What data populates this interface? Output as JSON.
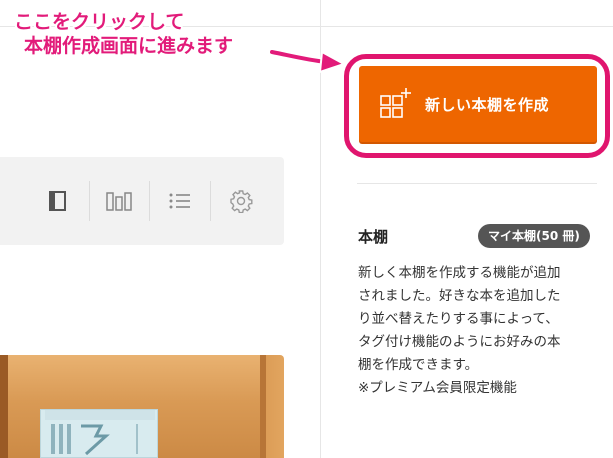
{
  "annotation": {
    "line1": "ここをクリックして",
    "line2": "本棚作成画面に進みます",
    "color": "#e21b7a"
  },
  "create_button": {
    "label": "新しい本棚を作成",
    "icon": "grid-plus-icon",
    "color": "#ee6600"
  },
  "toolbar": {
    "buttons": [
      {
        "icon": "single-book-view-icon"
      },
      {
        "icon": "shelf-view-icon"
      },
      {
        "icon": "list-view-icon"
      },
      {
        "icon": "gear-icon"
      }
    ]
  },
  "shelf": {
    "title": "本棚",
    "badge": "マイ本棚(50 冊)",
    "description": [
      "新しく本棚を作成する機能が追加",
      "されました。好きな本を追加した",
      "り並べ替えたりする事によって、",
      "タグ付け機能のようにお好みの本",
      "棚を作成できます。",
      "※プレミアム会員限定機能"
    ]
  }
}
